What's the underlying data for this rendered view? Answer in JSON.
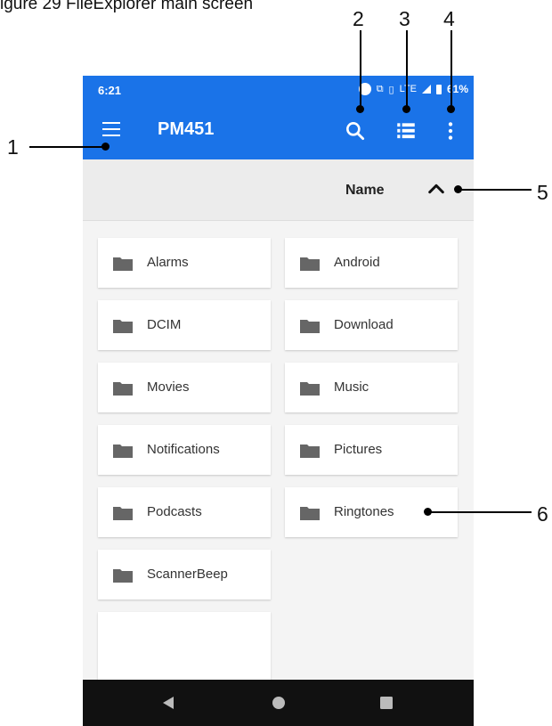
{
  "caption": "igure 29 FileExplorer main screen",
  "callouts": [
    "1",
    "2",
    "3",
    "4",
    "5",
    "6"
  ],
  "status_bar": {
    "time": "6:21",
    "network": "LTE",
    "battery": "61%"
  },
  "app_bar": {
    "title": "PM451",
    "icons": [
      "menu-icon",
      "search-icon",
      "list-view-icon",
      "more-vert-icon"
    ]
  },
  "sort_bar": {
    "label": "Name",
    "direction_icon": "chevron-up-icon"
  },
  "folders": [
    {
      "name": "Alarms"
    },
    {
      "name": "Android"
    },
    {
      "name": "DCIM"
    },
    {
      "name": "Download"
    },
    {
      "name": "Movies"
    },
    {
      "name": "Music"
    },
    {
      "name": "Notifications"
    },
    {
      "name": "Pictures"
    },
    {
      "name": "Podcasts"
    },
    {
      "name": "Ringtones"
    },
    {
      "name": "ScannerBeep"
    }
  ],
  "nav_bar": {
    "icons": [
      "back-icon",
      "home-icon",
      "recents-icon"
    ]
  },
  "colors": {
    "accent": "#1a73e8",
    "background": "#f4f4f4",
    "folder_icon": "#666666"
  }
}
